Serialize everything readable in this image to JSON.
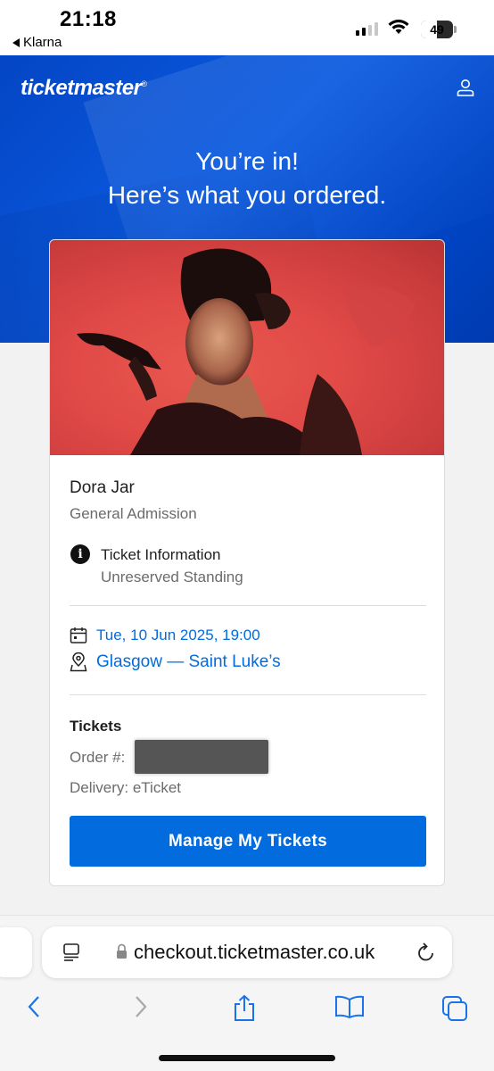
{
  "status_bar": {
    "time": "21:18",
    "back_app": "Klarna",
    "battery_percent": "49",
    "battery_level": 0.49
  },
  "header": {
    "logo": "ticketmaster",
    "logo_mark": "®",
    "headline_line1": "You’re in!",
    "headline_line2": "Here’s what you ordered."
  },
  "order": {
    "event_name": "Dora Jar",
    "admission": "General Admission",
    "info_title": "Ticket Information",
    "info_subtitle": "Unreserved Standing",
    "date_time": "Tue, 10 Jun 2025, 19:00",
    "venue": "Glasgow — Saint Luke’s",
    "tickets_heading": "Tickets",
    "order_label": "Order #:",
    "delivery": "Delivery: eTicket",
    "manage_button": "Manage My Tickets"
  },
  "browser": {
    "url": "checkout.ticketmaster.co.uk"
  },
  "icons": {
    "account": "user-icon",
    "info": "info-icon",
    "calendar": "calendar-icon",
    "location": "location-pin-icon",
    "reader": "reader-icon",
    "lock": "lock-icon",
    "reload": "reload-icon",
    "back": "back-arrow-icon",
    "forward": "forward-arrow-icon",
    "share": "share-icon",
    "bookmarks": "bookmarks-icon",
    "tabs": "tabs-icon"
  },
  "colors": {
    "brand_blue": "#026cdf",
    "hero_blue": "#0a5ae0",
    "image_red": "#e14a47"
  }
}
